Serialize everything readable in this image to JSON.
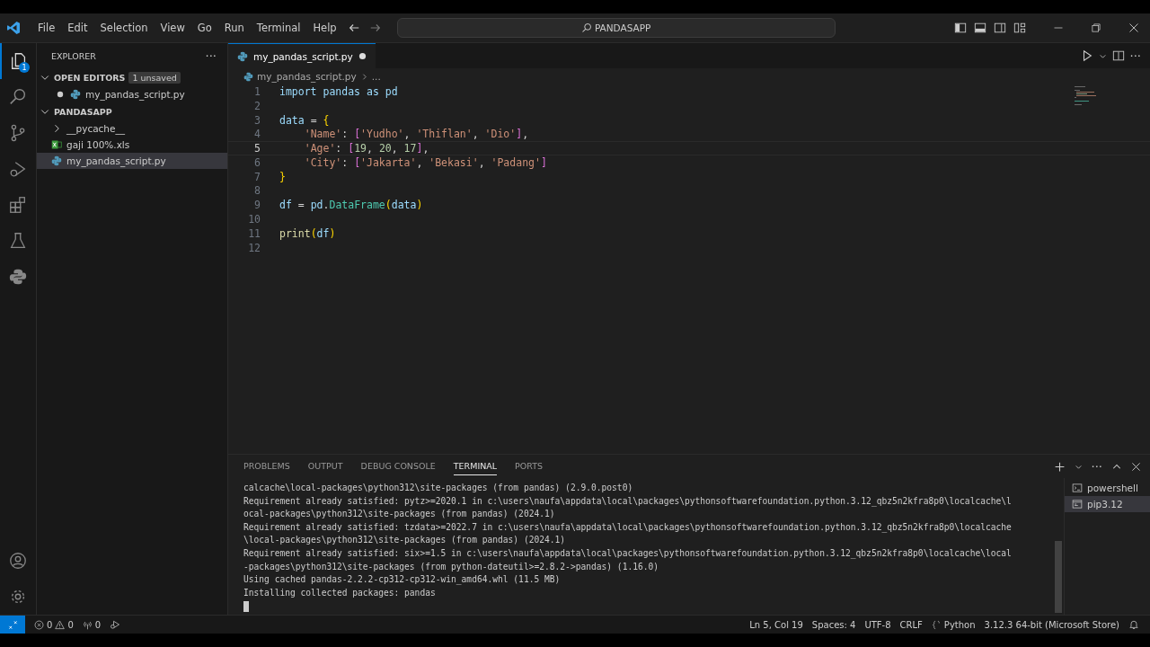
{
  "menu": [
    "File",
    "Edit",
    "Selection",
    "View",
    "Go",
    "Run",
    "Terminal",
    "Help"
  ],
  "command_center": {
    "label": "PANDASAPP"
  },
  "activity_bar": {
    "explorer_badge": "1",
    "items": [
      {
        "kind": "explorer",
        "selected": true
      },
      {
        "kind": "search",
        "selected": false
      },
      {
        "kind": "source_control",
        "selected": false
      },
      {
        "kind": "run_debug",
        "selected": false
      },
      {
        "kind": "extensions",
        "selected": false
      },
      {
        "kind": "testing",
        "selected": false
      },
      {
        "kind": "python",
        "selected": false
      }
    ]
  },
  "sidebar": {
    "title": "EXPLORER",
    "more": "···",
    "open_editors": {
      "label": "OPEN EDITORS",
      "badge": "1 unsaved",
      "expanded": true,
      "items": [
        {
          "name": "my_pandas_script.py",
          "unsaved": true,
          "selected": false
        }
      ]
    },
    "folder": {
      "label": "PANDASAPP",
      "expanded": true,
      "items": [
        {
          "name": "__pycache__",
          "kind": "folder",
          "expanded": false,
          "selected": false
        },
        {
          "name": "gaji 100%.xls",
          "kind": "excel",
          "selected": false
        },
        {
          "name": "my_pandas_script.py",
          "kind": "python",
          "selected": true
        }
      ]
    }
  },
  "editor": {
    "tabs": [
      {
        "label": "my_pandas_script.py",
        "unsaved": true,
        "selected": true
      }
    ],
    "breadcrumb": [
      "my_pandas_script.py",
      "..."
    ],
    "more": "···",
    "lines": [
      {
        "number": "1",
        "code": "import pandas as pd",
        "current": false
      },
      {
        "number": "2",
        "current": false
      },
      {
        "number": "3",
        "code": "data = {",
        "current": false
      },
      {
        "number": "4",
        "code": "    'Name': ['Yudho', 'Thiflan', 'Dio'],",
        "current": false
      },
      {
        "number": "5",
        "code": "    'Age': [19, 20, 17],",
        "current": true
      },
      {
        "number": "6",
        "code": "    'City': ['Jakarta', 'Bekasi', 'Padang']",
        "current": false
      },
      {
        "number": "7",
        "code": "}",
        "current": false
      },
      {
        "number": "8",
        "current": false
      },
      {
        "number": "9",
        "code": "df = pd.DataFrame(data)",
        "current": false
      },
      {
        "number": "10",
        "current": false
      },
      {
        "number": "11",
        "code": "print(df)",
        "current": false
      },
      {
        "number": "12",
        "current": false
      }
    ]
  },
  "panel": {
    "more": "···",
    "tabs": [
      {
        "label": "PROBLEMS",
        "selected": false
      },
      {
        "label": "OUTPUT",
        "selected": false
      },
      {
        "label": "DEBUG CONSOLE",
        "selected": false
      },
      {
        "label": "TERMINAL",
        "selected": true
      },
      {
        "label": "PORTS",
        "selected": false
      }
    ],
    "terminal_lines": [
      "calcache\\local-packages\\python312\\site-packages (from pandas) (2.9.0.post0)",
      "Requirement already satisfied: pytz>=2020.1 in c:\\users\\naufa\\appdata\\local\\packages\\pythonsoftwarefoundation.python.3.12_qbz5n2kfra8p0\\localcache\\l",
      "ocal-packages\\python312\\site-packages (from pandas) (2024.1)",
      "Requirement already satisfied: tzdata>=2022.7 in c:\\users\\naufa\\appdata\\local\\packages\\pythonsoftwarefoundation.python.3.12_qbz5n2kfra8p0\\localcache",
      "\\local-packages\\python312\\site-packages (from pandas) (2024.1)",
      "Requirement already satisfied: six>=1.5 in c:\\users\\naufa\\appdata\\local\\packages\\pythonsoftwarefoundation.python.3.12_qbz5n2kfra8p0\\localcache\\local",
      "-packages\\python312\\site-packages (from python-dateutil>=2.8.2->pandas) (1.16.0)",
      "Using cached pandas-2.2.2-cp312-cp312-win_amd64.whl (11.5 MB)",
      "Installing collected packages: pandas"
    ],
    "terminals": [
      {
        "label": "powershell",
        "kind": "powershell",
        "selected": false
      },
      {
        "label": "pip3.12",
        "kind": "cmd",
        "selected": true
      }
    ]
  },
  "status_bar": {
    "errors": "0",
    "warnings": "0",
    "ports": "0",
    "right": [
      "Ln 5, Col 19",
      "Spaces: 4",
      "UTF-8",
      "CRLF",
      "Python",
      "3.12.3 64-bit (Microsoft Store)"
    ]
  }
}
